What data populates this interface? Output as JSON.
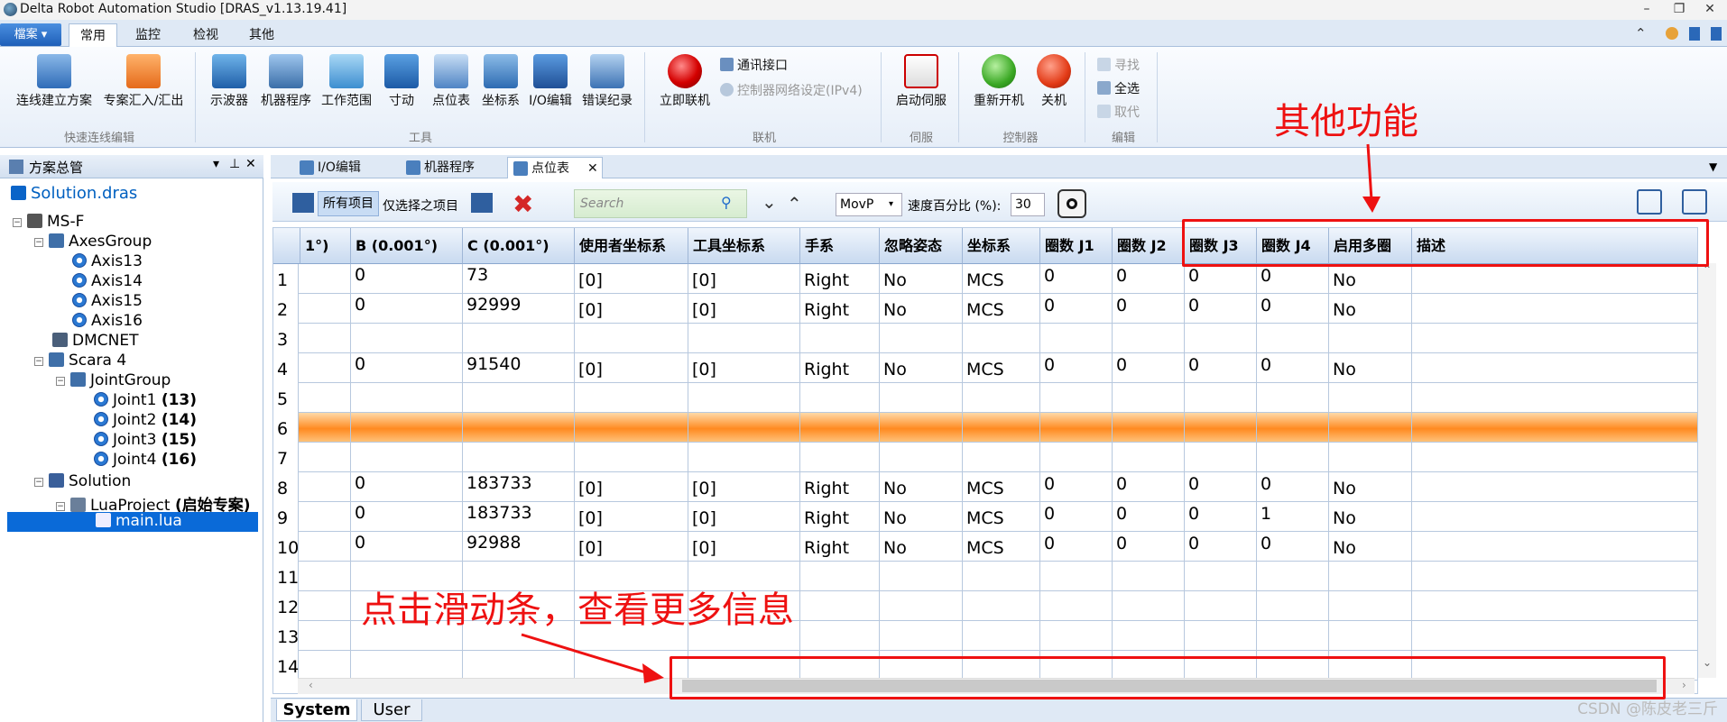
{
  "window": {
    "title": "Delta Robot Automation Studio [DRAS_v1.13.19.41]",
    "controls": [
      "–",
      "❐",
      "✕"
    ]
  },
  "ribbon": {
    "file_button": "檔案 ▾",
    "tabs": [
      "常用",
      "监控",
      "检视",
      "其他"
    ],
    "groups": [
      {
        "name": "快速连线编辑",
        "buttons": [
          "连线建立方案",
          "专案汇入/汇出"
        ]
      },
      {
        "name": "工具",
        "buttons": [
          "示波器",
          "机器程序",
          "工作范围",
          "寸动",
          "点位表",
          "坐标系",
          "I/O编辑",
          "错误纪录"
        ]
      },
      {
        "name": "联机",
        "buttons": [
          "立即联机"
        ],
        "small": [
          "通讯接口",
          "控制器网络设定(IPv4)"
        ]
      },
      {
        "name": "伺服",
        "buttons": [
          "启动伺服"
        ]
      },
      {
        "name": "控制器",
        "buttons": [
          "重新开机",
          "关机"
        ]
      },
      {
        "name": "编辑",
        "small": [
          "寻找",
          "全选",
          "取代"
        ]
      }
    ]
  },
  "left_panel": {
    "title": "方案总管",
    "header_icons": [
      "▾",
      "⊥",
      "✕"
    ],
    "solution_file": "Solution.dras",
    "tree": {
      "msf": "MS-F",
      "axes_group": "AxesGroup",
      "axes": [
        "Axis13",
        "Axis14",
        "Axis15",
        "Axis16"
      ],
      "dmcnet": "DMCNET",
      "scara": "Scara 4",
      "joint_group": "JointGroup",
      "joints": [
        {
          "name": "Joint1",
          "id": "(13)"
        },
        {
          "name": "Joint2",
          "id": "(14)"
        },
        {
          "name": "Joint3",
          "id": "(15)"
        },
        {
          "name": "Joint4",
          "id": "(16)"
        }
      ],
      "solution": "Solution",
      "lua_project": "LuaProject",
      "lua_project_tag": "(启始专案)",
      "main_lua": "main.lua"
    }
  },
  "doc_tabs": [
    {
      "label": "I/O编辑",
      "active": false
    },
    {
      "label": "机器程序",
      "active": false
    },
    {
      "label": "点位表",
      "active": true
    }
  ],
  "toolbar": {
    "all_items": "所有项目",
    "selected_items": "仅选择之项目",
    "search_placeholder": "Search",
    "motion": "MovP",
    "speed_label": "速度百分比 (%):",
    "speed_value": "30"
  },
  "table": {
    "headers": [
      "1°)",
      "B (0.001°)",
      "C (0.001°)",
      "使用者坐标系",
      "工具坐标系",
      "手系",
      "忽略姿态",
      "坐标系",
      "圈数 J1",
      "圈数 J2",
      "圈数 J3",
      "圈数 J4",
      "启用多圈",
      "描述"
    ],
    "rows": [
      {
        "n": "1",
        "c": [
          "",
          "0",
          "73",
          "[0]",
          "[0]",
          "Right",
          "No",
          "MCS",
          "0",
          "0",
          "0",
          "0",
          "No",
          ""
        ]
      },
      {
        "n": "2",
        "c": [
          "",
          "0",
          "92999",
          "[0]",
          "[0]",
          "Right",
          "No",
          "MCS",
          "0",
          "0",
          "0",
          "0",
          "No",
          ""
        ]
      },
      {
        "n": "3",
        "c": [
          "",
          "",
          "",
          "",
          "",
          "",
          "",
          "",
          "",
          "",
          "",
          "",
          "",
          ""
        ]
      },
      {
        "n": "4",
        "c": [
          "",
          "0",
          "91540",
          "[0]",
          "[0]",
          "Right",
          "No",
          "MCS",
          "0",
          "0",
          "0",
          "0",
          "No",
          ""
        ]
      },
      {
        "n": "5",
        "c": [
          "",
          "",
          "",
          "",
          "",
          "",
          "",
          "",
          "",
          "",
          "",
          "",
          "",
          ""
        ]
      },
      {
        "n": "6",
        "c": [
          "",
          "",
          "",
          "",
          "",
          "",
          "",
          "",
          "",
          "",
          "",
          "",
          "",
          ""
        ],
        "selected": true
      },
      {
        "n": "7",
        "c": [
          "",
          "",
          "",
          "",
          "",
          "",
          "",
          "",
          "",
          "",
          "",
          "",
          "",
          ""
        ]
      },
      {
        "n": "8",
        "c": [
          "",
          "0",
          "183733",
          "[0]",
          "[0]",
          "Right",
          "No",
          "MCS",
          "0",
          "0",
          "0",
          "0",
          "No",
          ""
        ]
      },
      {
        "n": "9",
        "c": [
          "",
          "0",
          "183733",
          "[0]",
          "[0]",
          "Right",
          "No",
          "MCS",
          "0",
          "0",
          "0",
          "1",
          "No",
          ""
        ]
      },
      {
        "n": "10",
        "c": [
          "",
          "0",
          "92988",
          "[0]",
          "[0]",
          "Right",
          "No",
          "MCS",
          "0",
          "0",
          "0",
          "0",
          "No",
          ""
        ]
      },
      {
        "n": "11",
        "c": [
          "",
          "",
          "",
          "",
          "",
          "",
          "",
          "",
          "",
          "",
          "",
          "",
          "",
          ""
        ]
      },
      {
        "n": "12",
        "c": [
          "",
          "",
          "",
          "",
          "",
          "",
          "",
          "",
          "",
          "",
          "",
          "",
          "",
          ""
        ]
      },
      {
        "n": "13",
        "c": [
          "",
          "",
          "",
          "",
          "",
          "",
          "",
          "",
          "",
          "",
          "",
          "",
          "",
          ""
        ]
      },
      {
        "n": "14",
        "c": [
          "",
          "",
          "",
          "",
          "",
          "",
          "",
          "",
          "",
          "",
          "",
          "",
          "",
          ""
        ]
      }
    ]
  },
  "bottom_tabs": [
    "System",
    "User"
  ],
  "annotations": {
    "other_features": "其他功能",
    "scrollbar_hint": "点击滑动条，查看更多信息"
  },
  "watermark": "CSDN @陈皮老三斤",
  "colors": {
    "accent_red": "#e11111",
    "selection_orange": "#ff8a20",
    "header_blue": "#c9daf0"
  }
}
